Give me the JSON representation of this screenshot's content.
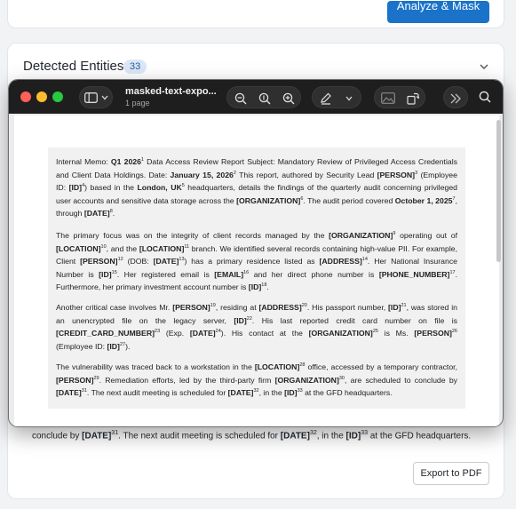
{
  "background": {
    "analyze_button": "Analyze & Mask",
    "entities_title": "Detected Entities",
    "entities_count": "33",
    "behind_text": {
      "p1": "conclude by ",
      "b1": "[DATE]",
      "s1": "31",
      "p2": ". The next audit meeting is scheduled for ",
      "b2": "[DATE]",
      "s2": "32",
      "p3": ", in the ",
      "b3": "[ID]",
      "s3": "33",
      "p4": " at the GFD headquarters."
    },
    "export_button": "Export to PDF"
  },
  "window": {
    "title": "masked-text-expo...",
    "subtitle": "1 page"
  },
  "document": {
    "p1": {
      "t1": "Internal Memo: ",
      "b1": "Q1 2026",
      "s1": "1",
      "t2": " Data Access Review Report Subject: Mandatory Review of Privileged Access Credentials and Client Data Holdings. Date: ",
      "b2": "January 15, 2026",
      "s2": "2",
      "t3": " This report, authored by Security Lead ",
      "b3": "[PERSON]",
      "s3": "3",
      "t4": " (Employee ID: ",
      "b4": "[ID]",
      "s4": "4",
      "t5": ") based in the ",
      "b5": "London, UK",
      "s5": "5",
      "t6": " headquarters, details the findings of the quarterly audit concerning privileged user accounts and sensitive data storage across the ",
      "b6": "[ORGANIZATION]",
      "s6": "6",
      "t7": ". The audit period covered ",
      "b7": "October 1, 2025",
      "s7": "7",
      "t8": ", through ",
      "b8": "[DATE]",
      "s8": "8",
      "t9": "."
    },
    "p2": {
      "t1": "The primary focus was on the integrity of client records managed by the ",
      "b1": "[ORGANIZATION]",
      "s1": "9",
      "t2": " operating out of ",
      "b2": "[LOCATION]",
      "s2": "10",
      "t3": ", and the ",
      "b3": "[LOCATION]",
      "s3": "11",
      "t4": " branch. We identified several records containing high-value PII. For example, Client ",
      "b4": "[PERSON]",
      "s4": "12",
      "t5": " (DOB: ",
      "b5": "[DATE]",
      "s5": "13",
      "t6": ") has a primary residence listed as ",
      "b6": "[ADDRESS]",
      "s6": "14",
      "t7": ". Her National Insurance Number is ",
      "b7": "[ID]",
      "s7": "15",
      "t8": ". Her registered email is ",
      "b8": "[EMAIL]",
      "s8": "16",
      "t9": " and her direct phone number is ",
      "b9": "[PHONE_NUMBER]",
      "s9": "17",
      "t10": ". Furthermore, her primary investment account number is ",
      "b10": "[ID]",
      "s10": "18",
      "t11": "."
    },
    "p3": {
      "t1": "Another critical case involves Mr. ",
      "b1": "[PERSON]",
      "s1": "19",
      "t2": ", residing at ",
      "b2": "[ADDRESS]",
      "s2": "20",
      "t3": ". His passport number, ",
      "b3": "[ID]",
      "s3": "21",
      "t4": ", was stored in an unencrypted file on the legacy server, ",
      "b4": "[ID]",
      "s4": "22",
      "t5": ". His last reported credit card number on file is ",
      "b5": "[CREDIT_CARD_NUMBER]",
      "s5": "23",
      "t6": " (Exp. ",
      "b6": "[DATE]",
      "s6": "24",
      "t7": "). His contact at the ",
      "b7": "[ORGANIZATION]",
      "s7": "25",
      "t8": " is Ms. ",
      "b8": "[PERSON]",
      "s8": "26",
      "t9": " (Employee ID: ",
      "b9": "[ID]",
      "s9": "27",
      "t10": ")."
    },
    "p4": {
      "t1": "The vulnerability was traced back to a workstation in the ",
      "b1": "[LOCATION]",
      "s1": "28",
      "t2": " office, accessed by a temporary contractor, ",
      "b2": "[PERSON]",
      "s2": "29",
      "t3": ". Remediation efforts, led by the third-party firm ",
      "b3": "[ORGANIZATION]",
      "s3": "30",
      "t4": ", are scheduled to conclude by ",
      "b4": "[DATE]",
      "s4": "31",
      "t5": ". The next audit meeting is scheduled for ",
      "b5": "[DATE]",
      "s5": "32",
      "t6": ", in the ",
      "b6": "[ID]",
      "s6": "33",
      "t7": " at the GFD headquarters."
    }
  },
  "colors": {
    "accent": "#1a73c9",
    "badge_bg": "#dbe7f7",
    "titlebar": "#1e1e1e"
  },
  "icons": [
    "sidebar-toggle-icon",
    "chevron-down-icon",
    "zoom-out-icon",
    "zoom-fit-icon",
    "zoom-in-icon",
    "markup-pen-icon",
    "image-tools-icon",
    "rotate-icon",
    "more-tools-icon",
    "search-icon"
  ]
}
